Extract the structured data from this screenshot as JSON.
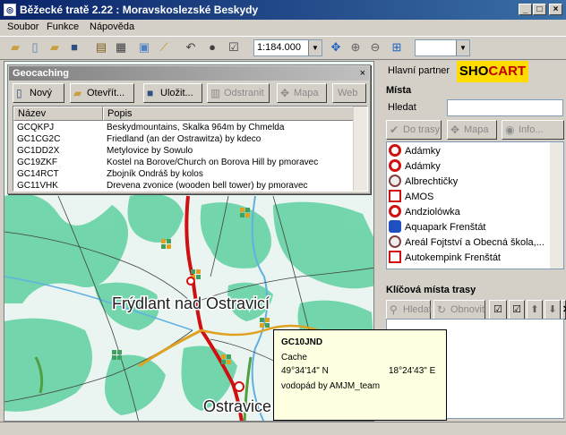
{
  "window": {
    "title": "Běžecké tratě 2.22 : Moravskoslezské Beskydy"
  },
  "menu": [
    "Soubor",
    "Funkce",
    "Nápověda"
  ],
  "toolbar": {
    "scale": "1:184.000"
  },
  "map": {
    "labels": {
      "town1": "Frýdlant nad Ostravicí",
      "town2": "Ostravice"
    },
    "colors": {
      "forest": "#5fd0a0",
      "background": "#eaf5f2",
      "road_major": "#d01010",
      "road_minor": "#e0a020"
    }
  },
  "geocaching": {
    "title": "Geocaching",
    "buttons": {
      "new": "Nový",
      "open": "Otevřít...",
      "save": "Uložit...",
      "delete": "Odstranit",
      "map": "Mapa",
      "web": "Web"
    },
    "columns": {
      "name": "Název",
      "desc": "Popis"
    },
    "rows": [
      {
        "name": "GCQKPJ",
        "desc": "Beskydmountains, Skalka 964m by Chmelda"
      },
      {
        "name": "GC1CG2C",
        "desc": "Friedland (an der Ostrawitza) by kdeco"
      },
      {
        "name": "GC1DD2X",
        "desc": "Metylovice by Sowulo"
      },
      {
        "name": "GC19ZKF",
        "desc": "Kostel na Borove/Church on Borova Hill by pmoravec"
      },
      {
        "name": "GC14RCT",
        "desc": "Zbojník Ondráš by kolos"
      },
      {
        "name": "GC11VHK",
        "desc": "Drevena zvonice (wooden bell tower) by pmoravec"
      }
    ]
  },
  "right_panel": {
    "tab": "Hlavní partner",
    "logo": {
      "part1": "SHO",
      "part2": "CART"
    },
    "places_title": "Místa",
    "search_label": "Hledat",
    "buttons": {
      "to_tracks": "Do trasy",
      "map": "Mapa",
      "info": "Info..."
    },
    "places": [
      {
        "name": "Adámky",
        "icon": "target-icon"
      },
      {
        "name": "Adámky",
        "icon": "target-icon"
      },
      {
        "name": "Albrechtičky",
        "icon": "compass-icon"
      },
      {
        "name": "AMOS",
        "icon": "house-icon"
      },
      {
        "name": "Andziolówka",
        "icon": "target-icon"
      },
      {
        "name": "Aquapark Frenštát",
        "icon": "pool-icon"
      },
      {
        "name": "Areál Fojtství a Obecná škola,...",
        "icon": "compass-icon"
      },
      {
        "name": "Autokempink Frenštát",
        "icon": "house-icon"
      }
    ],
    "track_title": "Klíčová místa trasy",
    "track_buttons": {
      "search": "Hledat",
      "refresh": "Obnovit"
    }
  },
  "tooltip": {
    "code": "GC10JND",
    "type": "Cache",
    "lat": "49°34'14\" N",
    "lon": "18°24'43\" E",
    "desc": "vodopád by AMJM_team"
  }
}
